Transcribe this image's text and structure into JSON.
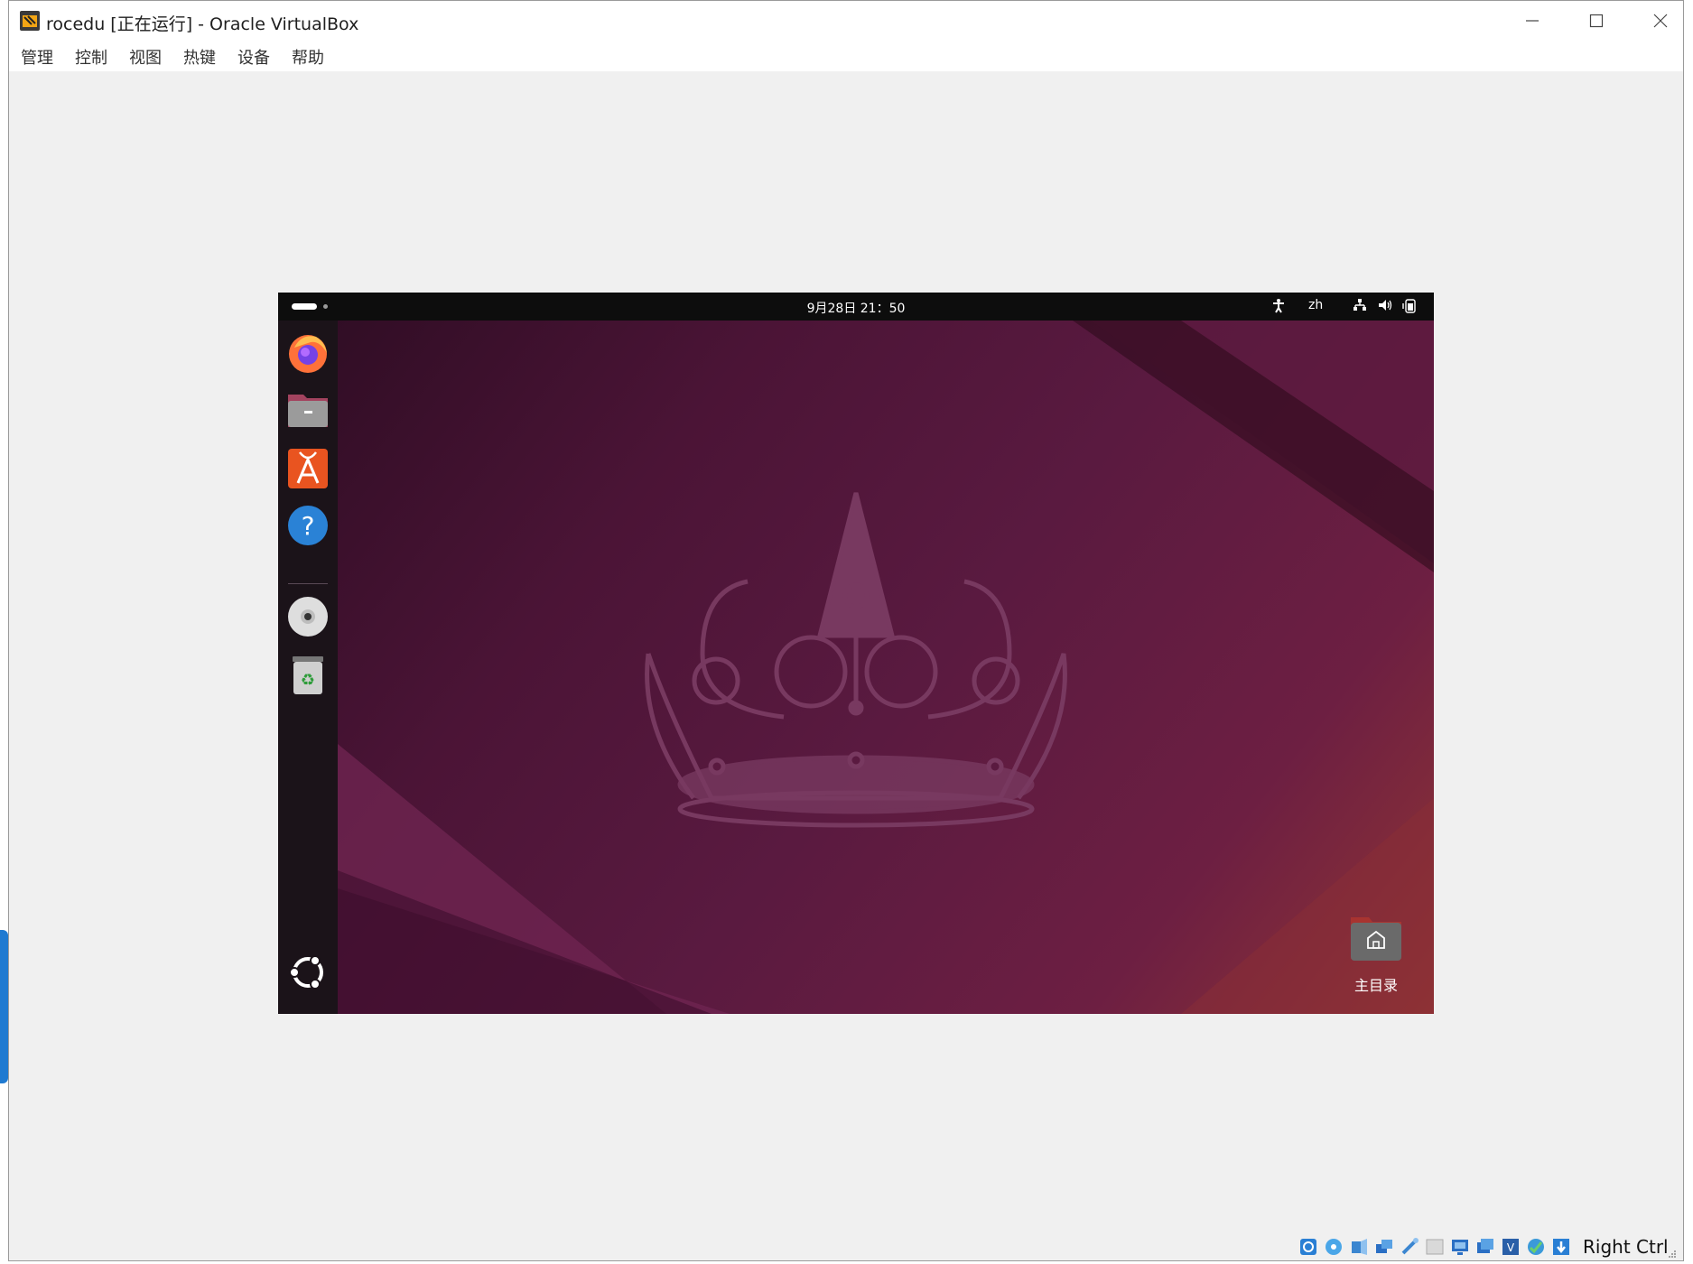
{
  "window": {
    "title": "rocedu [正在运行] - Oracle VirtualBox",
    "controls": {
      "minimize": "minimize-icon",
      "maximize": "maximize-icon",
      "close": "close-icon"
    }
  },
  "menubar": {
    "items": [
      "管理",
      "控制",
      "视图",
      "热键",
      "设备",
      "帮助"
    ]
  },
  "guest": {
    "topbar": {
      "datetime": "9月28日  21：50",
      "input_method": "zh"
    },
    "dock": {
      "apps": [
        "firefox-icon",
        "files-icon",
        "app-center-icon",
        "help-icon",
        "disc-icon",
        "trash-icon"
      ],
      "show_apps": "ubuntu-logo-icon"
    },
    "desktop": {
      "home_folder_label": "主目录"
    }
  },
  "statusbar": {
    "host_key": "Right Ctrl"
  },
  "colors": {
    "dock": "#1b1319",
    "topbar": "#0d0d0d",
    "wallpaper_base": "#5a1a40",
    "wallpaper_accent": "#913534"
  }
}
